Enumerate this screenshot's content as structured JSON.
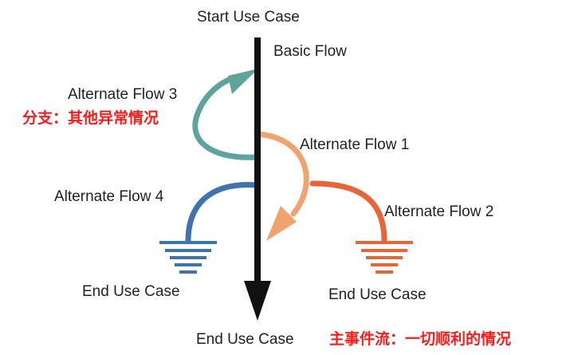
{
  "labels": {
    "start": "Start Use Case",
    "basic_flow": "Basic Flow",
    "alt_flow_3": "Alternate Flow 3",
    "alt_flow_1": "Alternate Flow 1",
    "alt_flow_4": "Alternate Flow 4",
    "alt_flow_2": "Alternate Flow 2",
    "end_left": "End Use Case",
    "end_right": "End Use Case",
    "end_main": "End Use Case"
  },
  "notes": {
    "branch": "分支：其他异常情况",
    "main": "主事件流：一切顺利的情况"
  },
  "colors": {
    "main_arrow": "#111111",
    "alt_flow_3": "#5fa49c",
    "alt_flow_1": "#f2a26e",
    "alt_flow_4": "#3f73ad",
    "alt_flow_2": "#e8653a",
    "note": "#ff1a1a"
  }
}
